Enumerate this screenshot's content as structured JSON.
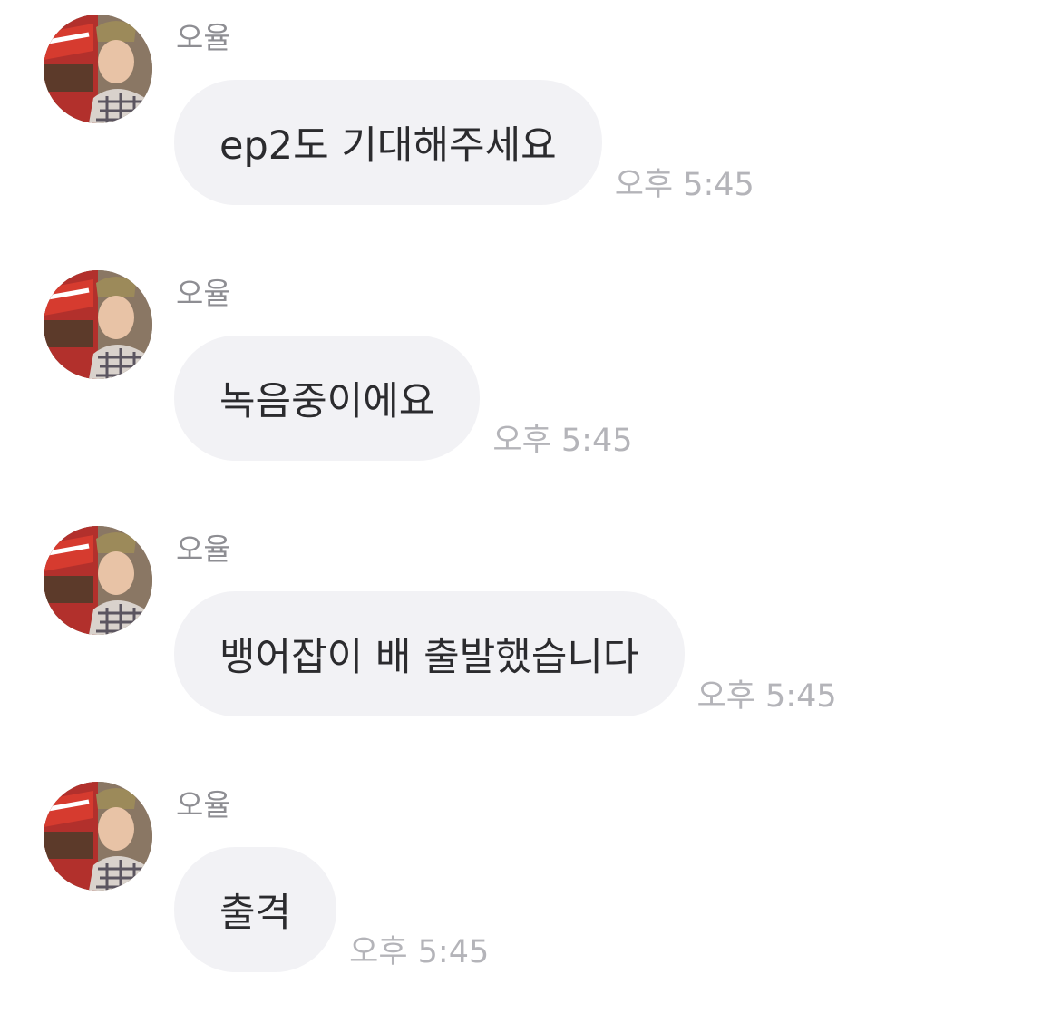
{
  "messages": [
    {
      "sender": "오율",
      "text": "ep2도 기대해주세요",
      "time": "오후 5:45"
    },
    {
      "sender": "오율",
      "text": "녹음중이에요",
      "time": "오후 5:45"
    },
    {
      "sender": "오율",
      "text": "뱅어잡이 배 출발했습니다",
      "time": "오후 5:45"
    },
    {
      "sender": "오율",
      "text": "출격",
      "time": "오후 5:45"
    }
  ],
  "colors": {
    "bubble_background": "#f2f2f5",
    "message_text": "#2b2b2e",
    "sender_name": "#8e8e93",
    "timestamp": "#b4b4b9"
  }
}
